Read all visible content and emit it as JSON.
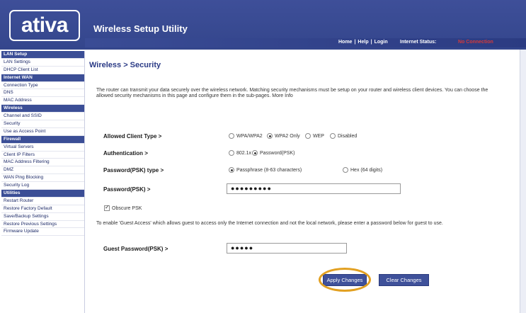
{
  "header": {
    "logo_text": "ativa",
    "app_title": "Wireless Setup Utility",
    "links": [
      "Home",
      "Help",
      "Login"
    ],
    "status_label": "Internet Status:",
    "status_value": "No Connection"
  },
  "sidebar": {
    "rows": [
      {
        "label": "LAN Setup",
        "type": "section"
      },
      {
        "label": "LAN Settings",
        "type": "item"
      },
      {
        "label": "DHCP Client List",
        "type": "item"
      },
      {
        "label": "Internet WAN",
        "type": "section"
      },
      {
        "label": "Connection Type",
        "type": "item"
      },
      {
        "label": "DNS",
        "type": "item"
      },
      {
        "label": "MAC Address",
        "type": "item"
      },
      {
        "label": "Wireless",
        "type": "section"
      },
      {
        "label": "Channel and SSID",
        "type": "item"
      },
      {
        "label": "Security",
        "type": "item"
      },
      {
        "label": "Use as Access Point",
        "type": "item"
      },
      {
        "label": "Firewall",
        "type": "section"
      },
      {
        "label": "Virtual Servers",
        "type": "item"
      },
      {
        "label": "Client IP Filters",
        "type": "item"
      },
      {
        "label": "MAC Address Filtering",
        "type": "item"
      },
      {
        "label": "DMZ",
        "type": "item"
      },
      {
        "label": "WAN Ping Blocking",
        "type": "item"
      },
      {
        "label": "Security Log",
        "type": "item"
      },
      {
        "label": "Utilities",
        "type": "section"
      },
      {
        "label": "Restart Router",
        "type": "item"
      },
      {
        "label": "Restore Factory Default",
        "type": "item"
      },
      {
        "label": "Save/Backup Settings",
        "type": "item"
      },
      {
        "label": "Restore Previous Settings",
        "type": "item"
      },
      {
        "label": "Firmware Update",
        "type": "item"
      }
    ]
  },
  "main": {
    "title": "Wireless > Security",
    "intro": "The router can transmit your data securely over the wireless network. Matching security mechanisms must be setup on your router and wireless client devices. You can choose the allowed security mechanisms in this page and configure them in the sub-pages. More Info",
    "allowed_client_type": {
      "label": "Allowed Client Type >",
      "options": [
        "WPA/WPA2",
        "WPA2 Only",
        "WEP",
        "Disabled"
      ],
      "selected": "WPA2 Only"
    },
    "authentication": {
      "label": "Authentication >",
      "options": [
        "802.1x",
        "Password(PSK)"
      ],
      "selected": "Password(PSK)"
    },
    "psk_type": {
      "label": "Password(PSK) type >",
      "options": [
        "Passphrase (8-63 characters)",
        "Hex (64 digits)"
      ],
      "selected": "Passphrase (8-63 characters)"
    },
    "password": {
      "label": "Password(PSK) >",
      "value": "●●●●●●●●●"
    },
    "obscure": {
      "label": "Obscure PSK",
      "checked": true
    },
    "guest_desc": "To enable 'Guest Access' which allows guest to access only the Internet connection and not the local network, please enter a password below for guest to use.",
    "guest_password": {
      "label": "Guest Password(PSK) >",
      "value": "●●●●●"
    },
    "buttons": {
      "apply": "Apply Changes",
      "clear": "Clear Changes"
    }
  },
  "colors": {
    "header_bg": "#3e4f99",
    "section_bg": "#3b4e96",
    "title_text": "#2b3b86",
    "status_red": "#d43a3a",
    "highlight_ring": "#e2a021"
  }
}
